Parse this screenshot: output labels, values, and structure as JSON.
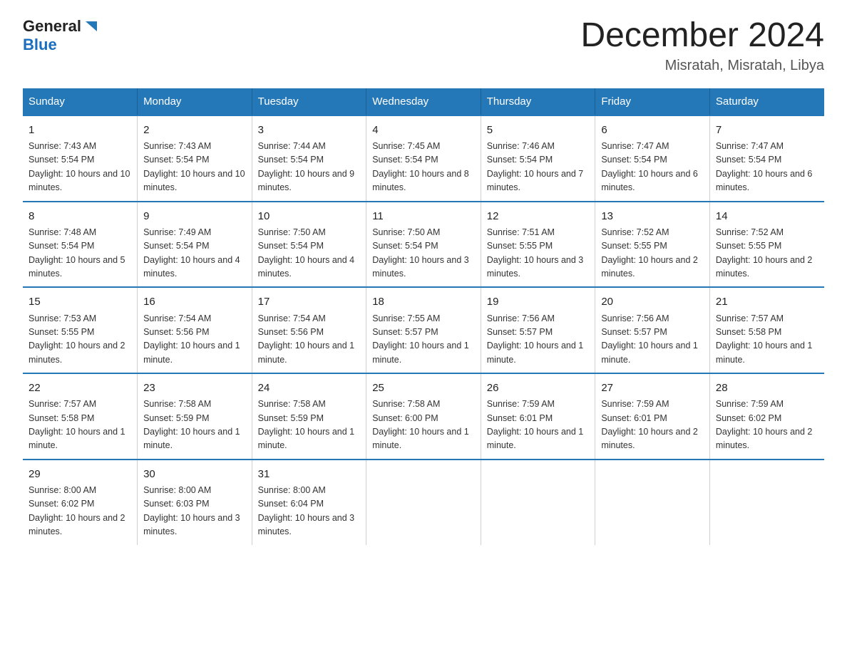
{
  "header": {
    "logo_general": "General",
    "logo_blue": "Blue",
    "title": "December 2024",
    "subtitle": "Misratah, Misratah, Libya"
  },
  "days_of_week": [
    "Sunday",
    "Monday",
    "Tuesday",
    "Wednesday",
    "Thursday",
    "Friday",
    "Saturday"
  ],
  "weeks": [
    [
      {
        "day": "1",
        "sunrise": "7:43 AM",
        "sunset": "5:54 PM",
        "daylight": "10 hours and 10 minutes."
      },
      {
        "day": "2",
        "sunrise": "7:43 AM",
        "sunset": "5:54 PM",
        "daylight": "10 hours and 10 minutes."
      },
      {
        "day": "3",
        "sunrise": "7:44 AM",
        "sunset": "5:54 PM",
        "daylight": "10 hours and 9 minutes."
      },
      {
        "day": "4",
        "sunrise": "7:45 AM",
        "sunset": "5:54 PM",
        "daylight": "10 hours and 8 minutes."
      },
      {
        "day": "5",
        "sunrise": "7:46 AM",
        "sunset": "5:54 PM",
        "daylight": "10 hours and 7 minutes."
      },
      {
        "day": "6",
        "sunrise": "7:47 AM",
        "sunset": "5:54 PM",
        "daylight": "10 hours and 6 minutes."
      },
      {
        "day": "7",
        "sunrise": "7:47 AM",
        "sunset": "5:54 PM",
        "daylight": "10 hours and 6 minutes."
      }
    ],
    [
      {
        "day": "8",
        "sunrise": "7:48 AM",
        "sunset": "5:54 PM",
        "daylight": "10 hours and 5 minutes."
      },
      {
        "day": "9",
        "sunrise": "7:49 AM",
        "sunset": "5:54 PM",
        "daylight": "10 hours and 4 minutes."
      },
      {
        "day": "10",
        "sunrise": "7:50 AM",
        "sunset": "5:54 PM",
        "daylight": "10 hours and 4 minutes."
      },
      {
        "day": "11",
        "sunrise": "7:50 AM",
        "sunset": "5:54 PM",
        "daylight": "10 hours and 3 minutes."
      },
      {
        "day": "12",
        "sunrise": "7:51 AM",
        "sunset": "5:55 PM",
        "daylight": "10 hours and 3 minutes."
      },
      {
        "day": "13",
        "sunrise": "7:52 AM",
        "sunset": "5:55 PM",
        "daylight": "10 hours and 2 minutes."
      },
      {
        "day": "14",
        "sunrise": "7:52 AM",
        "sunset": "5:55 PM",
        "daylight": "10 hours and 2 minutes."
      }
    ],
    [
      {
        "day": "15",
        "sunrise": "7:53 AM",
        "sunset": "5:55 PM",
        "daylight": "10 hours and 2 minutes."
      },
      {
        "day": "16",
        "sunrise": "7:54 AM",
        "sunset": "5:56 PM",
        "daylight": "10 hours and 1 minute."
      },
      {
        "day": "17",
        "sunrise": "7:54 AM",
        "sunset": "5:56 PM",
        "daylight": "10 hours and 1 minute."
      },
      {
        "day": "18",
        "sunrise": "7:55 AM",
        "sunset": "5:57 PM",
        "daylight": "10 hours and 1 minute."
      },
      {
        "day": "19",
        "sunrise": "7:56 AM",
        "sunset": "5:57 PM",
        "daylight": "10 hours and 1 minute."
      },
      {
        "day": "20",
        "sunrise": "7:56 AM",
        "sunset": "5:57 PM",
        "daylight": "10 hours and 1 minute."
      },
      {
        "day": "21",
        "sunrise": "7:57 AM",
        "sunset": "5:58 PM",
        "daylight": "10 hours and 1 minute."
      }
    ],
    [
      {
        "day": "22",
        "sunrise": "7:57 AM",
        "sunset": "5:58 PM",
        "daylight": "10 hours and 1 minute."
      },
      {
        "day": "23",
        "sunrise": "7:58 AM",
        "sunset": "5:59 PM",
        "daylight": "10 hours and 1 minute."
      },
      {
        "day": "24",
        "sunrise": "7:58 AM",
        "sunset": "5:59 PM",
        "daylight": "10 hours and 1 minute."
      },
      {
        "day": "25",
        "sunrise": "7:58 AM",
        "sunset": "6:00 PM",
        "daylight": "10 hours and 1 minute."
      },
      {
        "day": "26",
        "sunrise": "7:59 AM",
        "sunset": "6:01 PM",
        "daylight": "10 hours and 1 minute."
      },
      {
        "day": "27",
        "sunrise": "7:59 AM",
        "sunset": "6:01 PM",
        "daylight": "10 hours and 2 minutes."
      },
      {
        "day": "28",
        "sunrise": "7:59 AM",
        "sunset": "6:02 PM",
        "daylight": "10 hours and 2 minutes."
      }
    ],
    [
      {
        "day": "29",
        "sunrise": "8:00 AM",
        "sunset": "6:02 PM",
        "daylight": "10 hours and 2 minutes."
      },
      {
        "day": "30",
        "sunrise": "8:00 AM",
        "sunset": "6:03 PM",
        "daylight": "10 hours and 3 minutes."
      },
      {
        "day": "31",
        "sunrise": "8:00 AM",
        "sunset": "6:04 PM",
        "daylight": "10 hours and 3 minutes."
      },
      null,
      null,
      null,
      null
    ]
  ],
  "labels": {
    "sunrise": "Sunrise: ",
    "sunset": "Sunset: ",
    "daylight": "Daylight: "
  }
}
